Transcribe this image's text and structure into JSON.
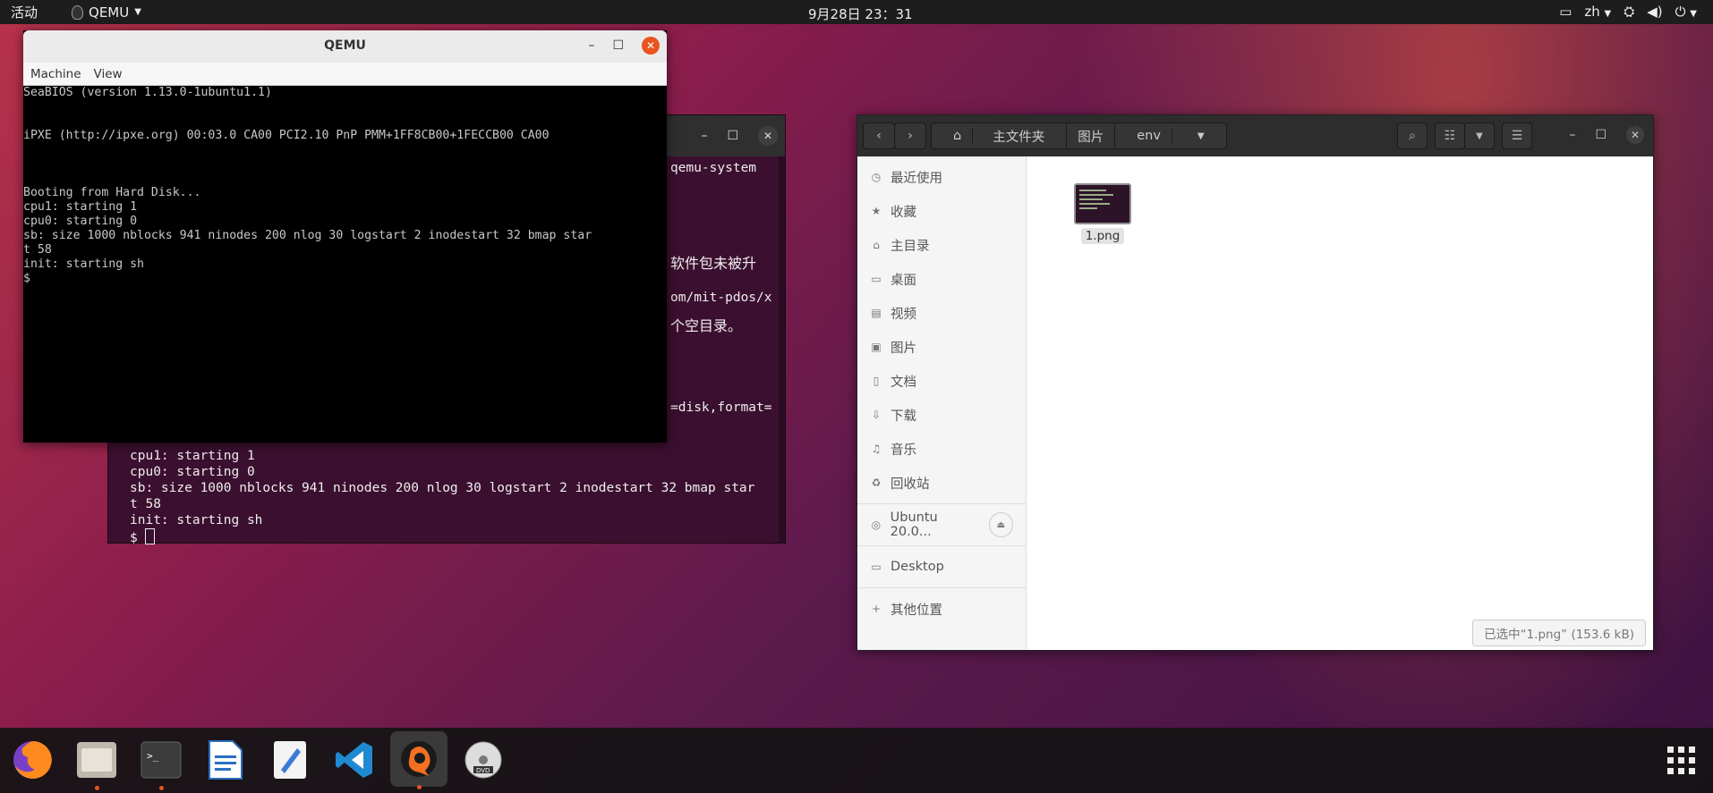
{
  "topbar": {
    "activities": "活动",
    "app_name": "QEMU",
    "clock": "9月28日 23：31",
    "lang": "zh"
  },
  "terminal": {
    "fragments": [
      "qemu-system",
      "软件包未被升",
      "om/mit-pdos/x",
      "个空目录。",
      "=disk,format="
    ],
    "lines": [
      "cpu1: starting 1",
      "cpu0: starting 0",
      "sb: size 1000 nblocks 941 ninodes 200 nlog 30 logstart 2 inodestart 32 bmap star",
      "t 58",
      "init: starting sh",
      "$ "
    ]
  },
  "qemu": {
    "title": "QEMU",
    "menu": [
      "Machine",
      "View"
    ],
    "console": "SeaBIOS (version 1.13.0-1ubuntu1.1)\n\n\niPXE (http://ipxe.org) 00:03.0 CA00 PCI2.10 PnP PMM+1FF8CB00+1FECCB00 CA00\n\n\n\nBooting from Hard Disk...\ncpu1: starting 1\ncpu0: starting 0\nsb: size 1000 nblocks 941 ninodes 200 nlog 30 logstart 2 inodestart 32 bmap star\nt 58\ninit: starting sh\n$"
  },
  "files": {
    "breadcrumb": [
      "主文件夹",
      "图片",
      "env"
    ],
    "sidebar": [
      {
        "label": "最近使用",
        "icon": "clock-icon"
      },
      {
        "label": "收藏",
        "icon": "star-icon"
      },
      {
        "label": "主目录",
        "icon": "home-icon"
      },
      {
        "label": "桌面",
        "icon": "desktop-icon"
      },
      {
        "label": "视频",
        "icon": "video-icon"
      },
      {
        "label": "图片",
        "icon": "picture-icon"
      },
      {
        "label": "文档",
        "icon": "document-icon"
      },
      {
        "label": "下载",
        "icon": "download-icon"
      },
      {
        "label": "音乐",
        "icon": "music-icon"
      },
      {
        "label": "回收站",
        "icon": "trash-icon"
      }
    ],
    "device": "Ubuntu 20.0...",
    "bookmark": "Desktop",
    "other": "其他位置",
    "file": {
      "name": "1.png"
    },
    "status": "已选中“1.png” (153.6 kB)"
  },
  "dock": {
    "apps": [
      "firefox-icon",
      "files-icon",
      "terminal-icon",
      "writer-icon",
      "text-editor-icon",
      "vscode-icon",
      "qemu-icon",
      "dvd-icon"
    ]
  }
}
